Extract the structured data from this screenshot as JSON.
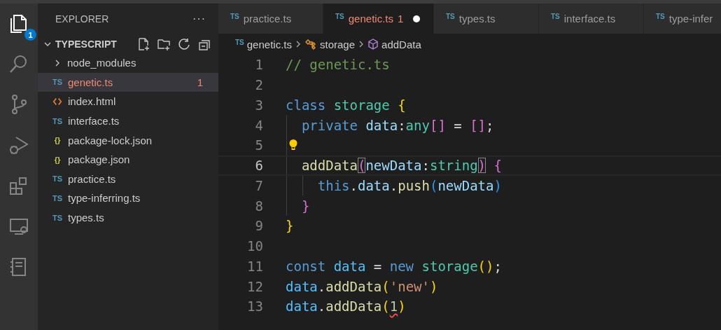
{
  "activity_bar": {
    "items": [
      {
        "kind": "files",
        "selected": true,
        "badge": "1"
      },
      {
        "kind": "search",
        "selected": false
      },
      {
        "kind": "source-control",
        "selected": false
      },
      {
        "kind": "debug",
        "selected": false
      },
      {
        "kind": "extensions",
        "selected": false
      },
      {
        "kind": "remote",
        "selected": false
      },
      {
        "kind": "notebook",
        "selected": false
      }
    ]
  },
  "sidebar": {
    "title": "EXPLORER",
    "more": "···",
    "folder": {
      "name": "TYPESCRIPT",
      "expanded": true
    },
    "items": [
      {
        "kind": "folder",
        "name": "node_modules",
        "expanded": false,
        "selected": false,
        "error": false
      },
      {
        "kind": "ts",
        "icon": "TS",
        "name": "genetic.ts",
        "count": "1",
        "selected": true,
        "error": true
      },
      {
        "kind": "html",
        "name": "index.html",
        "selected": false,
        "error": false
      },
      {
        "kind": "ts",
        "icon": "TS",
        "name": "interface.ts",
        "selected": false,
        "error": false
      },
      {
        "kind": "json",
        "icon": "{}",
        "name": "package-lock.json",
        "selected": false,
        "error": false
      },
      {
        "kind": "json",
        "icon": "{}",
        "name": "package.json",
        "selected": false,
        "error": false
      },
      {
        "kind": "ts",
        "icon": "TS",
        "name": "practice.ts",
        "selected": false,
        "error": false
      },
      {
        "kind": "ts",
        "icon": "TS",
        "name": "type-inferring.ts",
        "selected": false,
        "error": false
      },
      {
        "kind": "ts",
        "icon": "TS",
        "name": "types.ts",
        "selected": false,
        "error": false
      }
    ]
  },
  "tabs": [
    {
      "icon": "TS",
      "label": "practice.ts",
      "selected": false,
      "error": false,
      "dirty": false
    },
    {
      "icon": "TS",
      "label": "genetic.ts",
      "count": "1",
      "selected": true,
      "error": true,
      "dirty": true
    },
    {
      "icon": "TS",
      "label": "types.ts",
      "selected": false,
      "error": false,
      "dirty": false
    },
    {
      "icon": "TS",
      "label": "interface.ts",
      "selected": false,
      "error": false,
      "dirty": false
    },
    {
      "icon": "TS",
      "label": "type-infer",
      "selected": false,
      "error": false,
      "dirty": false
    }
  ],
  "breadcrumb": [
    {
      "kind": "file",
      "icon": "TS",
      "label": "genetic.ts"
    },
    {
      "kind": "class",
      "label": "storage"
    },
    {
      "kind": "method",
      "label": "addData"
    }
  ],
  "code": [
    {
      "number": "1",
      "current": false,
      "lightbulb": false,
      "tokens": [
        {
          "comment": "// genetic.ts"
        }
      ]
    },
    {
      "number": "2",
      "current": false,
      "lightbulb": false
    },
    {
      "number": "3",
      "current": false,
      "lightbulb": false,
      "tokens": [
        {
          "keyword": "class "
        },
        {
          "type": "storage "
        },
        {
          "bracket1": "{"
        }
      ]
    },
    {
      "number": "4",
      "current": false,
      "lightbulb": false,
      "tokens": [
        {
          "keyword": "  private "
        },
        {
          "variable": "data"
        },
        {
          "plain": ":"
        },
        {
          "type": "any"
        },
        {
          "bracket2": "[]"
        },
        {
          "plain": " = "
        },
        {
          "bracket2": "[]"
        },
        {
          "plain": ";"
        }
      ]
    },
    {
      "number": "5",
      "current": false,
      "lightbulb": true
    },
    {
      "number": "6",
      "current": true,
      "lightbulb": false,
      "tokens": [
        {
          "function": "  addData"
        },
        {
          "bracket2": "(",
          "matched": true
        },
        {
          "variable": "newData"
        },
        {
          "plain": ":"
        },
        {
          "type": "string"
        },
        {
          "bracket2": ")",
          "matched": true
        },
        {
          "bracket2": " {"
        }
      ]
    },
    {
      "number": "7",
      "current": false,
      "lightbulb": false,
      "tokens": [
        {
          "keyword": "    this"
        },
        {
          "plain": "."
        },
        {
          "variable": "data"
        },
        {
          "plain": "."
        },
        {
          "function": "push"
        },
        {
          "bracket3": "("
        },
        {
          "variable": "newData"
        },
        {
          "bracket3": ")"
        }
      ]
    },
    {
      "number": "8",
      "current": false,
      "lightbulb": false,
      "tokens": [
        {
          "bracket2": "  }"
        }
      ]
    },
    {
      "number": "9",
      "current": false,
      "lightbulb": false,
      "tokens": [
        {
          "bracket1": "}"
        }
      ]
    },
    {
      "number": "10",
      "current": false,
      "lightbulb": false
    },
    {
      "number": "11",
      "current": false,
      "lightbulb": false,
      "tokens": [
        {
          "keyword": "const "
        },
        {
          "constant": "data"
        },
        {
          "plain": " = "
        },
        {
          "keyword": "new "
        },
        {
          "type": "storage"
        },
        {
          "bracket1": "()"
        },
        {
          "plain": ";"
        }
      ]
    },
    {
      "number": "12",
      "current": false,
      "lightbulb": false,
      "tokens": [
        {
          "constant": "data"
        },
        {
          "plain": "."
        },
        {
          "function": "addData"
        },
        {
          "bracket1": "("
        },
        {
          "string": "'new'"
        },
        {
          "bracket1": ")"
        }
      ]
    },
    {
      "number": "13",
      "current": false,
      "lightbulb": false,
      "tokens": [
        {
          "constant": "data"
        },
        {
          "plain": "."
        },
        {
          "function": "addData"
        },
        {
          "bracket1": "("
        },
        {
          "number": "1",
          "error": true
        },
        {
          "bracket1": ")"
        }
      ]
    }
  ]
}
